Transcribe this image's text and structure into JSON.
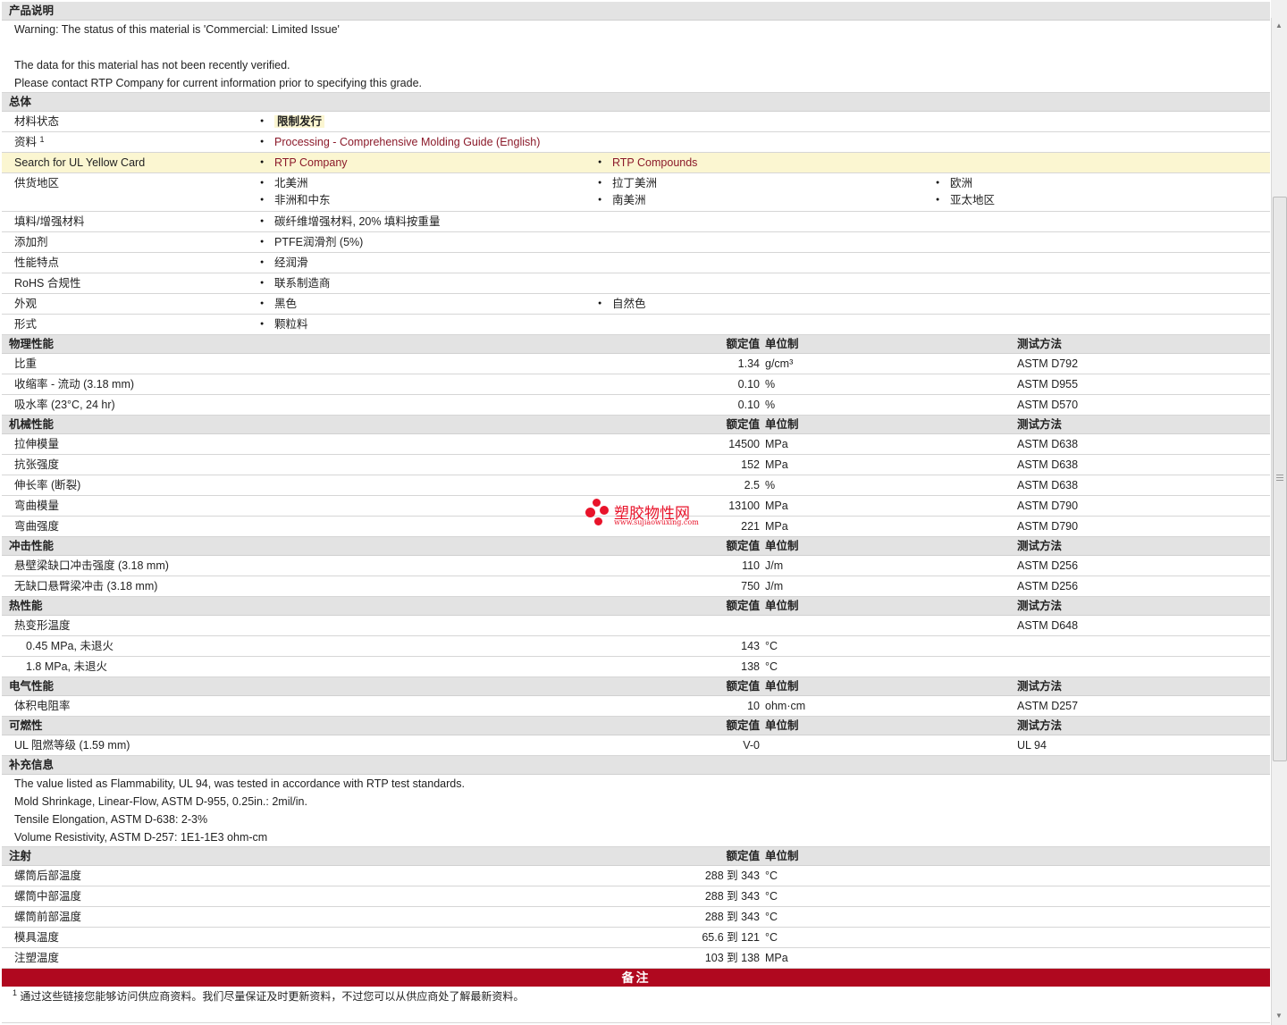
{
  "product_desc": {
    "title": "产品说明",
    "line1": "Warning: The status of this material is 'Commercial: Limited Issue'",
    "line2": "The data for this material has not been recently verified.",
    "line3": "Please contact RTP Company for current information prior to specifying this grade."
  },
  "general": {
    "title": "总体",
    "status_label": "材料状态",
    "status_value": "限制发行",
    "docs_label": "资料",
    "docs_sup": "1",
    "docs_link": "Processing - Comprehensive Molding Guide (English)",
    "ul_label": "Search for UL Yellow Card",
    "ul_link1": "RTP Company",
    "ul_link2": "RTP Compounds",
    "region_label": "供货地区",
    "regions": [
      "北美洲",
      "拉丁美洲",
      "欧洲",
      "非洲和中东",
      "南美洲",
      "亚太地区"
    ],
    "filler_label": "填料/增强材料",
    "filler_value": "碳纤维增强材料, 20% 填料按重量",
    "additive_label": "添加剂",
    "additive_value": "PTFE润滑剂 (5%)",
    "feature_label": "性能特点",
    "feature_value": "经润滑",
    "rohs_label": "RoHS 合规性",
    "rohs_value": "联系制造商",
    "appearance_label": "外观",
    "appearance_values": [
      "黑色",
      "自然色"
    ],
    "form_label": "形式",
    "form_value": "颗粒料"
  },
  "headers": {
    "value": "额定值",
    "unit": "单位制",
    "method": "测试方法"
  },
  "physical": {
    "title": "物理性能",
    "rows": [
      {
        "label": "比重",
        "value": "1.34",
        "unit": "g/cm³",
        "method": "ASTM D792"
      },
      {
        "label": "收缩率  - 流动 (3.18 mm)",
        "value": "0.10",
        "unit": "%",
        "method": "ASTM D955"
      },
      {
        "label": "吸水率 (23°C, 24 hr)",
        "value": "0.10",
        "unit": "%",
        "method": "ASTM D570"
      }
    ]
  },
  "mechanical": {
    "title": "机械性能",
    "rows": [
      {
        "label": "拉伸模量",
        "value": "14500",
        "unit": "MPa",
        "method": "ASTM D638"
      },
      {
        "label": "抗张强度",
        "value": "152",
        "unit": "MPa",
        "method": "ASTM D638"
      },
      {
        "label": "伸长率 (断裂)",
        "value": "2.5",
        "unit": "%",
        "method": "ASTM D638"
      },
      {
        "label": "弯曲模量",
        "value": "13100",
        "unit": "MPa",
        "method": "ASTM D790"
      },
      {
        "label": "弯曲强度",
        "value": "221",
        "unit": "MPa",
        "method": "ASTM D790"
      }
    ]
  },
  "impact": {
    "title": "冲击性能",
    "rows": [
      {
        "label": "悬壁梁缺口冲击强度 (3.18 mm)",
        "value": "110",
        "unit": "J/m",
        "method": "ASTM D256"
      },
      {
        "label": "无缺口悬臂梁冲击 (3.18 mm)",
        "value": "750",
        "unit": "J/m",
        "method": "ASTM D256"
      }
    ]
  },
  "thermal": {
    "title": "热性能",
    "hdt_label": "热变形温度",
    "hdt_method": "ASTM D648",
    "rows": [
      {
        "label": "0.45 MPa, 未退火",
        "value": "143",
        "unit": "°C"
      },
      {
        "label": "1.8 MPa, 未退火",
        "value": "138",
        "unit": "°C"
      }
    ]
  },
  "electrical": {
    "title": "电气性能",
    "rows": [
      {
        "label": "体积电阻率",
        "value": "10",
        "unit": "ohm·cm",
        "method": "ASTM D257"
      }
    ]
  },
  "flammability": {
    "title": "可燃性",
    "rows": [
      {
        "label": "UL 阻燃等级 (1.59 mm)",
        "value": "V-0",
        "unit": "",
        "method": "UL 94"
      }
    ]
  },
  "supplement": {
    "title": "补充信息",
    "lines": [
      "The value listed as Flammability, UL 94, was tested in accordance with RTP test standards.",
      "Mold Shrinkage, Linear-Flow, ASTM D-955, 0.25in.: 2mil/in.",
      "Tensile Elongation, ASTM D-638: 2-3%",
      "Volume Resistivity, ASTM D-257: 1E1-1E3 ohm-cm"
    ]
  },
  "injection": {
    "title": "注射",
    "rows": [
      {
        "label": "螺筒后部温度",
        "value": "288 到  343",
        "unit": "°C"
      },
      {
        "label": "螺筒中部温度",
        "value": "288 到  343",
        "unit": "°C"
      },
      {
        "label": "螺筒前部温度",
        "value": "288 到  343",
        "unit": "°C"
      },
      {
        "label": "模具温度",
        "value": "65.6 到  121",
        "unit": "°C"
      },
      {
        "label": "注塑温度",
        "value": "103 到  138",
        "unit": "MPa"
      }
    ]
  },
  "notes": {
    "title": "备注",
    "sup": "1",
    "text": "通过这些链接您能够访问供应商资料。我们尽量保证及时更新资料，不过您可以从供应商处了解最新资料。"
  },
  "watermark": {
    "text": "塑胶物性网",
    "url": "www.sujiaowuxing.com",
    "color": "#e8132a"
  }
}
